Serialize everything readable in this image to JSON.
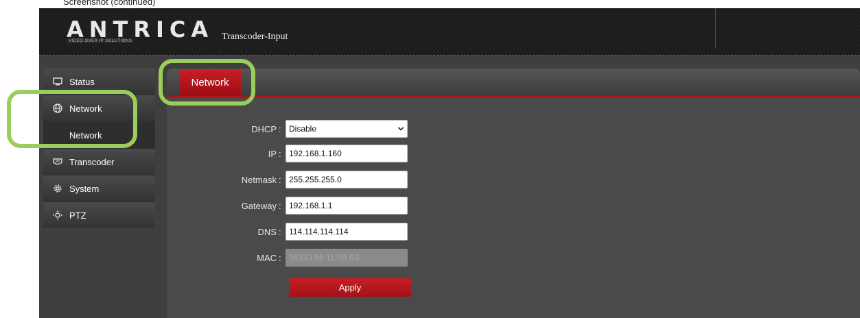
{
  "caption": "Screenshot (continued)",
  "header": {
    "logo": "ANTRICA",
    "logo_tagline": "VIDEO OVER IP SOLUTIONS",
    "title": "Transcoder-Input"
  },
  "sidebar": {
    "items": [
      {
        "label": "Status",
        "icon": "monitor-icon"
      },
      {
        "label": "Network",
        "icon": "globe-icon"
      },
      {
        "label": "Network",
        "icon": ""
      },
      {
        "label": "Transcoder",
        "icon": "transcoder-icon"
      },
      {
        "label": "System",
        "icon": "gear-icon"
      },
      {
        "label": "PTZ",
        "icon": "ptz-icon"
      }
    ]
  },
  "tab": {
    "label": "Network"
  },
  "form": {
    "dhcp": {
      "label": "DHCP",
      "value": "Disable"
    },
    "ip": {
      "label": "IP",
      "value": "192.168.1.160"
    },
    "netmask": {
      "label": "Netmask",
      "value": "255.255.255.0"
    },
    "gateway": {
      "label": "Gateway",
      "value": "192.168.1.1"
    },
    "dns": {
      "label": "DNS",
      "value": "114.114.114.114"
    },
    "mac": {
      "label": "MAC",
      "value": "56:DD:56:11:5B:B6"
    },
    "colon": ":"
  },
  "apply_label": "Apply",
  "colors": {
    "accent_red": "#b3121b",
    "highlight_green": "#9ccc5b",
    "panel_bg": "#4a4a4a"
  }
}
